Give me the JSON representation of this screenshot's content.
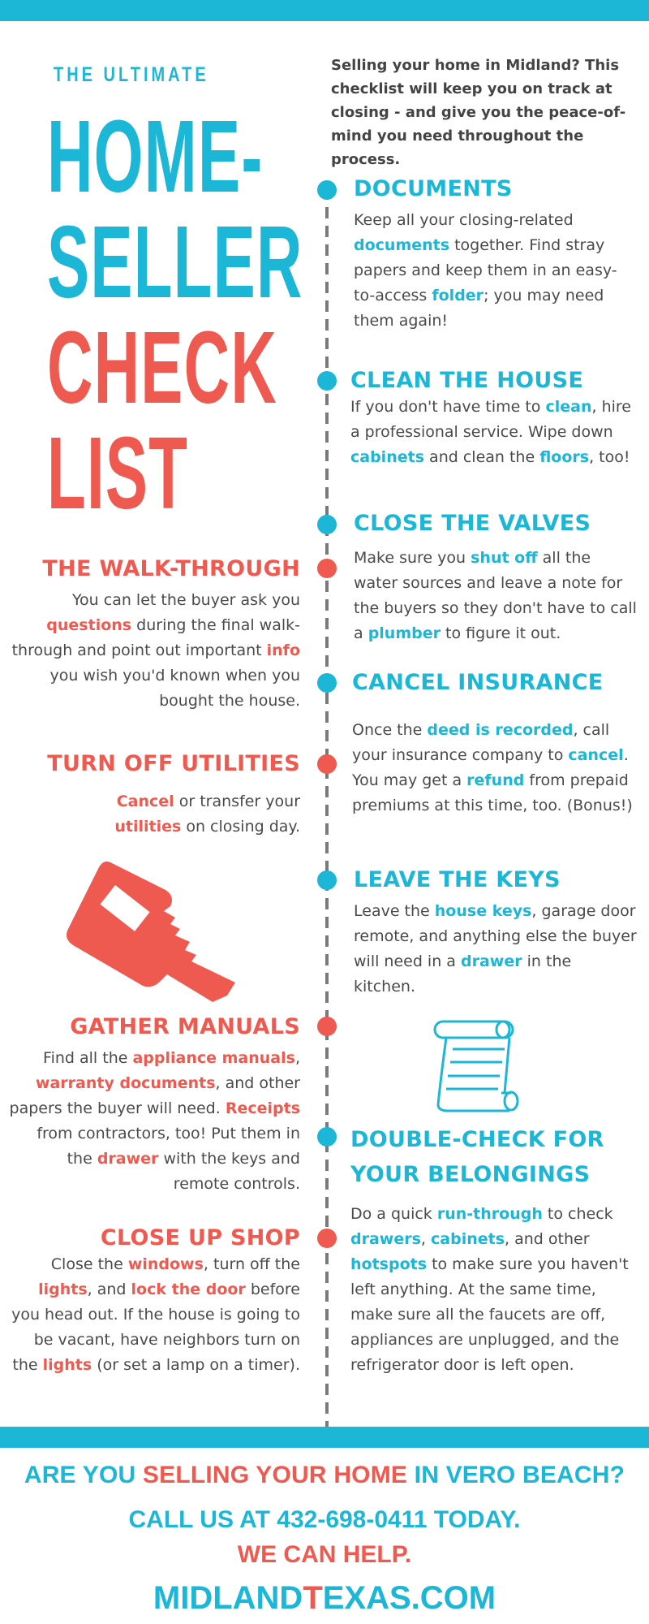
{
  "colors": {
    "accent_blue": "#1cb6d6",
    "accent_red": "#ee5a50",
    "body_text": "#4a4a4a",
    "timeline": "#7a7a7a"
  },
  "title": {
    "kicker": "THE ULTIMATE",
    "line1": "HOME-",
    "line2": "SELLER",
    "line3": "CHECK",
    "line4": "LIST"
  },
  "intro": "Selling your home in Midland? This checklist will keep you on track at closing - and give you the peace-of-mind you need throughout the process.",
  "sections": {
    "documents": {
      "heading": "DOCUMENTS",
      "parts": [
        "Keep all your closing-related ",
        "documents",
        " together. Find stray papers and keep them in an easy-to-access ",
        "folder",
        "; you may need them again!"
      ]
    },
    "clean": {
      "heading": "CLEAN THE HOUSE",
      "parts": [
        "If you don't have time to ",
        "clean",
        ", hire a professional service. Wipe down ",
        "cabinets",
        " and clean the ",
        "floors",
        ", too!"
      ]
    },
    "valves": {
      "heading": "CLOSE THE VALVES",
      "parts": [
        "Make sure you ",
        "shut off",
        " all the water sources and leave a note for the buyers so they don't have to call a ",
        "plumber",
        " to figure it out."
      ]
    },
    "walkthrough": {
      "heading": "THE WALK-THROUGH",
      "parts": [
        "You can let the buyer ask you ",
        "questions",
        " during the final walk-through and point out important ",
        "info",
        " you wish you'd known when you bought the house."
      ]
    },
    "insurance": {
      "heading": "CANCEL INSURANCE",
      "parts": [
        "Once the ",
        "deed is recorded",
        ", call your insurance company to ",
        "cancel",
        ". You may get a ",
        "refund",
        " from prepaid premiums at this time, too. (Bonus!)"
      ]
    },
    "utilities": {
      "heading": "TURN OFF UTILITIES",
      "parts": [
        "",
        "Cancel",
        " or transfer your ",
        "utilities",
        " on closing day."
      ]
    },
    "keys": {
      "heading": "LEAVE THE KEYS",
      "parts": [
        "Leave the ",
        "house keys",
        ", garage door remote, and anything else the buyer will need in a ",
        "drawer",
        " in the kitchen."
      ]
    },
    "manuals": {
      "heading": "GATHER MANUALS",
      "parts": [
        "Find all the ",
        "appliance manuals",
        ", ",
        "warranty documents",
        ", and other papers the buyer will need. ",
        "Receipts",
        " from contractors, too! Put them in the ",
        "drawer",
        " with the keys and remote controls."
      ]
    },
    "belongings": {
      "heading": "DOUBLE-CHECK FOR YOUR BELONGINGS",
      "parts": [
        "Do a quick ",
        "run-through",
        " to check ",
        "drawers",
        ", ",
        "cabinets",
        ", and other ",
        "hotspots",
        " to make sure you haven't left anything. At the same time, make sure all the faucets are off, appliances are unplugged, and the refrigerator door is left open."
      ]
    },
    "shop": {
      "heading": "CLOSE UP SHOP",
      "parts": [
        "Close the ",
        "windows",
        ", turn off the ",
        "lights",
        ", and ",
        "lock the door",
        " before you head out. If the house is going to be vacant, have neighbors turn on the ",
        "lights",
        " (or set a lamp on a timer)."
      ]
    }
  },
  "icons": {
    "key": "key-icon",
    "scroll": "scroll-icon"
  },
  "footer": {
    "line1_a": "ARE YOU ",
    "line1_b": "SELLING YOUR HOME",
    "line1_c": " IN VERO BEACH?",
    "line2": "CALL US AT 432-698-0411 TODAY.",
    "line3": "WE CAN HELP.",
    "site_a": "MIDLAND",
    "site_b": "T",
    "site_c": "EXAS.COM"
  }
}
